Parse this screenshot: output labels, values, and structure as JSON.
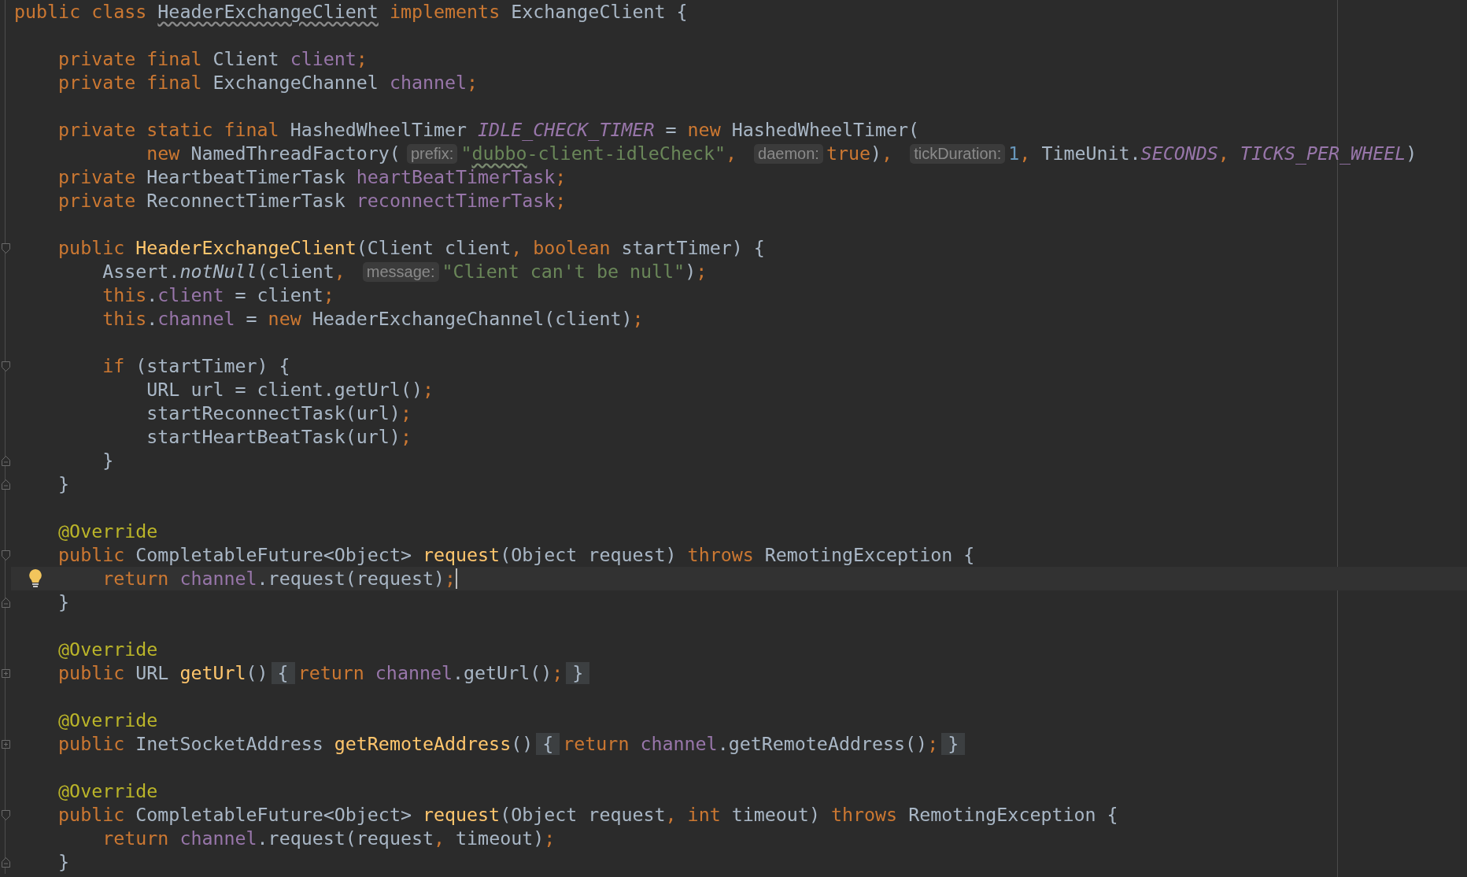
{
  "editor": {
    "lines": [
      {
        "current": false,
        "tokens": [
          {
            "keyword": "public class "
          },
          {
            "misspelled": "HeaderExchangeClient"
          },
          {
            "keyword": " implements "
          },
          {
            "plain": "ExchangeClient {"
          }
        ],
        "children": [
          {
            "current": false
          },
          {
            "current": false,
            "tokens": [
              {
                "keyword": "private final "
              },
              {
                "plain": "Client "
              },
              {
                "field": "client"
              },
              {
                "keyword": ";"
              }
            ]
          },
          {
            "current": false,
            "tokens": [
              {
                "keyword": "private final "
              },
              {
                "plain": "ExchangeChannel "
              },
              {
                "field": "channel"
              },
              {
                "keyword": ";"
              }
            ]
          },
          {
            "current": false
          },
          {
            "current": false,
            "tokens": [
              {
                "keyword": "private static final "
              },
              {
                "plain": "HashedWheelTimer "
              },
              {
                "constant": "IDLE_CHECK_TIMER"
              },
              {
                "plain": " = "
              },
              {
                "keyword": "new "
              },
              {
                "plain": "HashedWheelTimer("
              }
            ],
            "continuation": {
              "current": false,
              "tokens": [
                {
                  "keyword": "new "
                },
                {
                  "plain": "NamedThreadFactory("
                },
                {
                  "hint": "prefix:"
                },
                {
                  "string": "\""
                },
                {
                  "misspelled_string": "dubbo"
                },
                {
                  "string": "-client-idleCheck\""
                },
                {
                  "keyword": ", "
                },
                {
                  "hint": "daemon:"
                },
                {
                  "keyword": "true"
                },
                {
                  "plain": ")"
                },
                {
                  "keyword": ", "
                },
                {
                  "hint": "tickDuration:"
                },
                {
                  "number": "1"
                },
                {
                  "keyword": ", "
                },
                {
                  "plain": "TimeUnit."
                },
                {
                  "constant": "SECONDS"
                },
                {
                  "keyword": ", "
                },
                {
                  "constant": "TICKS_PER_WHEEL"
                },
                {
                  "plain": ")"
                }
              ]
            }
          },
          {
            "current": false,
            "tokens": [
              {
                "keyword": "private "
              },
              {
                "plain": "HeartbeatTimerTask "
              },
              {
                "field": "heartBeatTimerTask"
              },
              {
                "keyword": ";"
              }
            ]
          },
          {
            "current": false,
            "tokens": [
              {
                "keyword": "private "
              },
              {
                "plain": "ReconnectTimerTask "
              },
              {
                "field": "reconnectTimerTask"
              },
              {
                "keyword": ";"
              }
            ]
          },
          {
            "current": false
          },
          {
            "current": false,
            "marker": {
              "kind": "fold-start"
            },
            "tokens": [
              {
                "keyword": "public "
              },
              {
                "declaration": "HeaderExchangeClient"
              },
              {
                "plain": "(Client client"
              },
              {
                "keyword": ", "
              },
              {
                "keyword": "boolean "
              },
              {
                "plain": "startTimer) {"
              }
            ],
            "children": [
              {
                "current": false,
                "tokens": [
                  {
                    "plain": "Assert."
                  },
                  {
                    "static_call": "notNull"
                  },
                  {
                    "plain": "(client"
                  },
                  {
                    "keyword": ", "
                  },
                  {
                    "hint": "message:"
                  },
                  {
                    "string": "\"Client can't be null\""
                  },
                  {
                    "plain": ")"
                  },
                  {
                    "keyword": ";"
                  }
                ]
              },
              {
                "current": false,
                "tokens": [
                  {
                    "keyword": "this"
                  },
                  {
                    "plain": "."
                  },
                  {
                    "field": "client"
                  },
                  {
                    "plain": " = client"
                  },
                  {
                    "keyword": ";"
                  }
                ]
              },
              {
                "current": false,
                "tokens": [
                  {
                    "keyword": "this"
                  },
                  {
                    "plain": "."
                  },
                  {
                    "field": "channel"
                  },
                  {
                    "plain": " = "
                  },
                  {
                    "keyword": "new "
                  },
                  {
                    "plain": "HeaderExchangeChannel(client)"
                  },
                  {
                    "keyword": ";"
                  }
                ]
              },
              {
                "current": false
              },
              {
                "current": false,
                "marker": {
                  "kind": "fold-start"
                },
                "tokens": [
                  {
                    "keyword": "if "
                  },
                  {
                    "plain": "(startTimer) {"
                  }
                ],
                "children": [
                  {
                    "current": false,
                    "tokens": [
                      {
                        "plain": "URL url = client.getUrl()"
                      },
                      {
                        "keyword": ";"
                      }
                    ]
                  },
                  {
                    "current": false,
                    "tokens": [
                      {
                        "plain": "startReconnectTask(url)"
                      },
                      {
                        "keyword": ";"
                      }
                    ]
                  },
                  {
                    "current": false,
                    "tokens": [
                      {
                        "plain": "startHeartBeatTask(url)"
                      },
                      {
                        "keyword": ";"
                      }
                    ]
                  }
                ]
              },
              {
                "current": false,
                "marker": {
                  "kind": "fold-end"
                },
                "tokens": [
                  {
                    "plain": "}"
                  }
                ]
              }
            ]
          },
          {
            "current": false,
            "marker": {
              "kind": "fold-end"
            },
            "tokens": [
              {
                "plain": "}"
              }
            ]
          },
          {
            "current": false
          },
          {
            "current": false,
            "tokens": [
              {
                "annotation": "@Override"
              }
            ]
          },
          {
            "current": false,
            "marker": {
              "kind": "fold-start"
            },
            "tokens": [
              {
                "keyword": "public "
              },
              {
                "plain": "CompletableFuture<Object> "
              },
              {
                "declaration": "request"
              },
              {
                "plain": "(Object request) "
              },
              {
                "keyword": "throws "
              },
              {
                "plain": "RemotingException {"
              }
            ],
            "children": [
              {
                "current": true,
                "marker": {
                  "kind": "bulb"
                },
                "tokens": [
                  {
                    "keyword": "return "
                  },
                  {
                    "field": "channel"
                  },
                  {
                    "plain": ".request(request)"
                  },
                  {
                    "keyword": ";"
                  }
                ]
              }
            ]
          },
          {
            "current": false,
            "marker": {
              "kind": "fold-end"
            },
            "tokens": [
              {
                "plain": "}"
              }
            ]
          },
          {
            "current": false
          },
          {
            "current": false,
            "tokens": [
              {
                "annotation": "@Override"
              }
            ]
          },
          {
            "current": false,
            "marker": {
              "kind": "fold-collapsed"
            },
            "tokens": [
              {
                "keyword": "public "
              },
              {
                "plain": "URL "
              },
              {
                "declaration": "getUrl"
              },
              {
                "plain": "()"
              },
              {
                "folded": "{"
              },
              {
                "keyword": "return "
              },
              {
                "field": "channel"
              },
              {
                "plain": ".getUrl()"
              },
              {
                "keyword": ";"
              },
              {
                "folded": "}"
              }
            ]
          },
          {
            "current": false
          },
          {
            "current": false,
            "tokens": [
              {
                "annotation": "@Override"
              }
            ]
          },
          {
            "current": false,
            "marker": {
              "kind": "fold-collapsed"
            },
            "tokens": [
              {
                "keyword": "public "
              },
              {
                "plain": "InetSocketAddress "
              },
              {
                "declaration": "getRemoteAddress"
              },
              {
                "plain": "()"
              },
              {
                "folded": "{"
              },
              {
                "keyword": "return "
              },
              {
                "field": "channel"
              },
              {
                "plain": ".getRemoteAddress()"
              },
              {
                "keyword": ";"
              },
              {
                "folded": "}"
              }
            ]
          },
          {
            "current": false
          },
          {
            "current": false,
            "tokens": [
              {
                "annotation": "@Override"
              }
            ]
          },
          {
            "current": false,
            "marker": {
              "kind": "fold-start"
            },
            "tokens": [
              {
                "keyword": "public "
              },
              {
                "plain": "CompletableFuture<Object> "
              },
              {
                "declaration": "request"
              },
              {
                "plain": "(Object request"
              },
              {
                "keyword": ", "
              },
              {
                "keyword": "int "
              },
              {
                "plain": "timeout) "
              },
              {
                "keyword": "throws "
              },
              {
                "plain": "RemotingException {"
              }
            ],
            "children": [
              {
                "current": false,
                "tokens": [
                  {
                    "keyword": "return "
                  },
                  {
                    "field": "channel"
                  },
                  {
                    "plain": ".request(request"
                  },
                  {
                    "keyword": ", "
                  },
                  {
                    "plain": "timeout)"
                  },
                  {
                    "keyword": ";"
                  }
                ]
              }
            ]
          },
          {
            "current": false,
            "marker": {
              "kind": "fold-end"
            },
            "tokens": [
              {
                "plain": "}"
              }
            ]
          }
        ]
      }
    ]
  }
}
